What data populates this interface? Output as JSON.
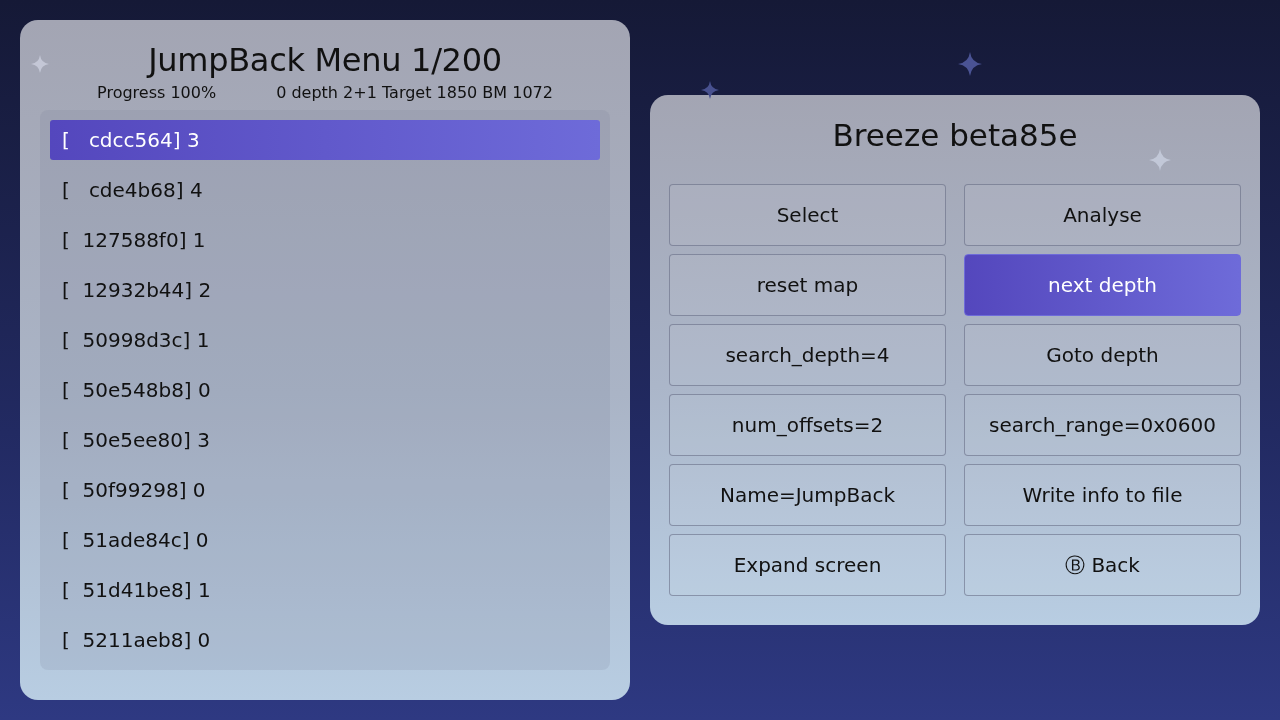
{
  "menu": {
    "title": "JumpBack Menu 1/200",
    "progress": "Progress 100%",
    "status": "0 depth 2+1 Target 1850 BM 1072",
    "items": [
      {
        "label": "[   cdcc564] 3",
        "selected": true
      },
      {
        "label": "[   cde4b68] 4",
        "selected": false
      },
      {
        "label": "[  127588f0] 1",
        "selected": false
      },
      {
        "label": "[  12932b44] 2",
        "selected": false
      },
      {
        "label": "[  50998d3c] 1",
        "selected": false
      },
      {
        "label": "[  50e548b8] 0",
        "selected": false
      },
      {
        "label": "[  50e5ee80] 3",
        "selected": false
      },
      {
        "label": "[  50f99298] 0",
        "selected": false
      },
      {
        "label": "[  51ade84c] 0",
        "selected": false
      },
      {
        "label": "[  51d41be8] 1",
        "selected": false
      },
      {
        "label": "[  5211aeb8] 0",
        "selected": false
      }
    ]
  },
  "panel": {
    "title": "Breeze beta85e",
    "buttons": [
      {
        "label": "Select",
        "selected": false
      },
      {
        "label": "Analyse",
        "selected": false
      },
      {
        "label": "reset map",
        "selected": false
      },
      {
        "label": "next depth",
        "selected": true
      },
      {
        "label": "search_depth=4",
        "selected": false
      },
      {
        "label": "Goto depth",
        "selected": false
      },
      {
        "label": "num_offsets=2",
        "selected": false
      },
      {
        "label": "search_range=0x0600",
        "selected": false
      },
      {
        "label": "Name=JumpBack",
        "selected": false
      },
      {
        "label": "Write info to file",
        "selected": false
      },
      {
        "label": "Expand screen",
        "selected": false
      },
      {
        "label": "Ⓑ Back",
        "selected": false
      }
    ]
  }
}
